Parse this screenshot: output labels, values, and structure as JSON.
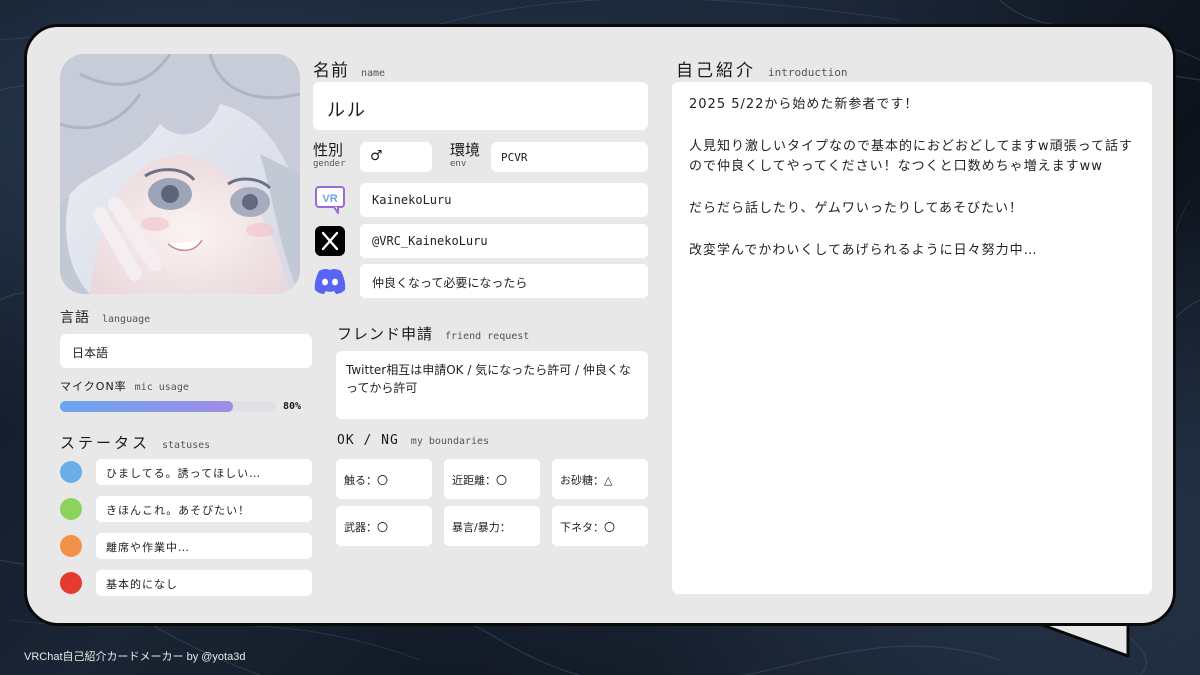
{
  "profile": {
    "name_label": "名前",
    "name_label_en": "name",
    "name": "ルル",
    "gender_label": "性別",
    "gender_label_en": "gender",
    "gender": "♂",
    "env_label": "環境",
    "env_label_en": "env",
    "env": "PCVR",
    "vrchat_id": "KainekoLuru",
    "twitter": "@VRC_KainekoLuru",
    "discord": "仲良くなって必要になったら"
  },
  "language": {
    "label": "言語",
    "label_en": "language",
    "value": "日本語"
  },
  "mic": {
    "label": "マイクON率",
    "label_en": "mic usage",
    "percent": 80,
    "percent_text": "80%",
    "bar_gradient": [
      "#6aa6ee",
      "#a18de6"
    ]
  },
  "statuses": {
    "label": "ステータス",
    "label_en": "statuses",
    "items": [
      {
        "color": "#6aaee8",
        "text": "ひましてる。誘ってほしい…"
      },
      {
        "color": "#8bd35a",
        "text": "きほんこれ。あそびたい！"
      },
      {
        "color": "#f0924a",
        "text": "離席や作業中…"
      },
      {
        "color": "#e53a2e",
        "text": "基本的になし"
      }
    ]
  },
  "friend_request": {
    "label": "フレンド申請",
    "label_en": "friend request",
    "text": "Twitter相互は申請OK / 気になったら許可 / 仲良くなってから許可"
  },
  "boundaries": {
    "label": "OK / NG",
    "label_en": "my boundaries",
    "items": [
      "触る：〇",
      "近距離：〇",
      "お砂糖：△",
      "武器：〇",
      "暴言/暴力：",
      "下ネタ：〇"
    ]
  },
  "intro": {
    "label": "自己紹介",
    "label_en": "introduction",
    "paragraphs": [
      "2025 5/22から始めた新参者です！",
      "人見知り激しいタイプなので基本的におどおどしてますw頑張って話すので仲良くしてやってください！なつくと口数めちゃ増えますww",
      "だらだら話したり、ゲムワいったりしてあそびたい！",
      "改変学んでかわいくしてあげられるように日々努力中…"
    ]
  },
  "icons": [
    "vrchat-icon",
    "x-icon",
    "discord-icon"
  ],
  "footer": "VRChat自己紹介カードメーカー by @yota3d"
}
